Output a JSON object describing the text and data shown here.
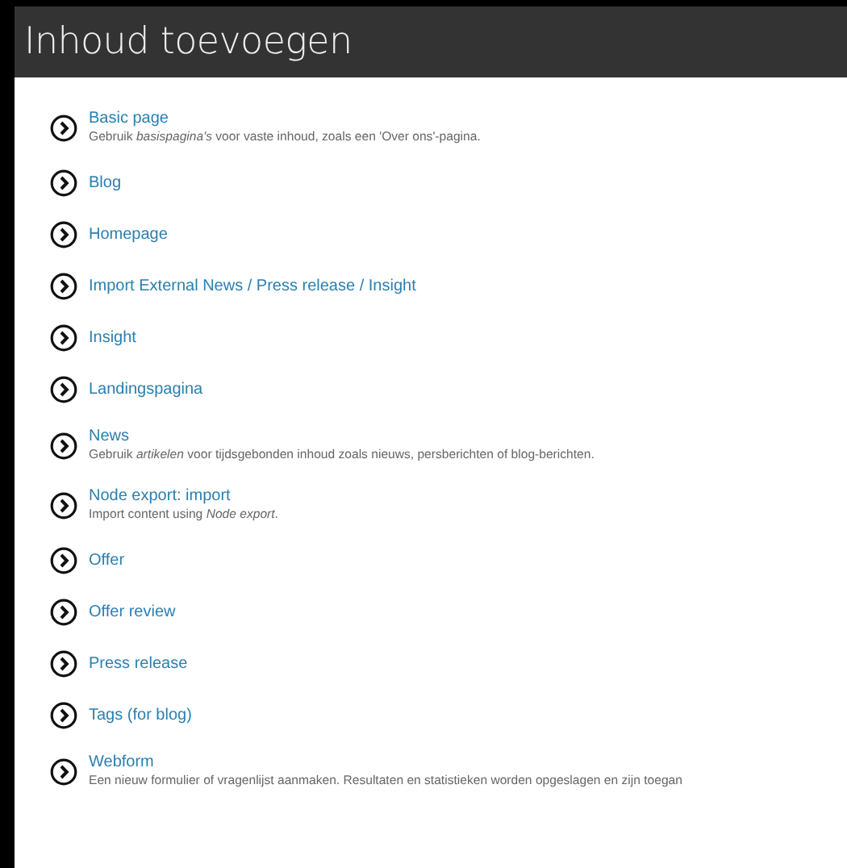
{
  "header": {
    "title": "Inhoud toevoegen"
  },
  "items": [
    {
      "label": "Basic page",
      "description": "Gebruik *basispagina's* voor vaste inhoud, zoals een 'Over ons'-pagina."
    },
    {
      "label": "Blog"
    },
    {
      "label": "Homepage"
    },
    {
      "label": "Import External News / Press release / Insight"
    },
    {
      "label": "Insight"
    },
    {
      "label": "Landingspagina"
    },
    {
      "label": "News",
      "description": "Gebruik *artikelen* voor tijdsgebonden inhoud zoals nieuws, persberichten of blog-berichten."
    },
    {
      "label": "Node export: import",
      "description": "Import content using *Node export*."
    },
    {
      "label": "Offer"
    },
    {
      "label": "Offer review"
    },
    {
      "label": "Press release"
    },
    {
      "label": "Tags (for blog)"
    },
    {
      "label": "Webform",
      "description": "Een nieuw formulier of vragenlijst aanmaken. Resultaten en statistieken worden opgeslagen en zijn toegan"
    }
  ]
}
